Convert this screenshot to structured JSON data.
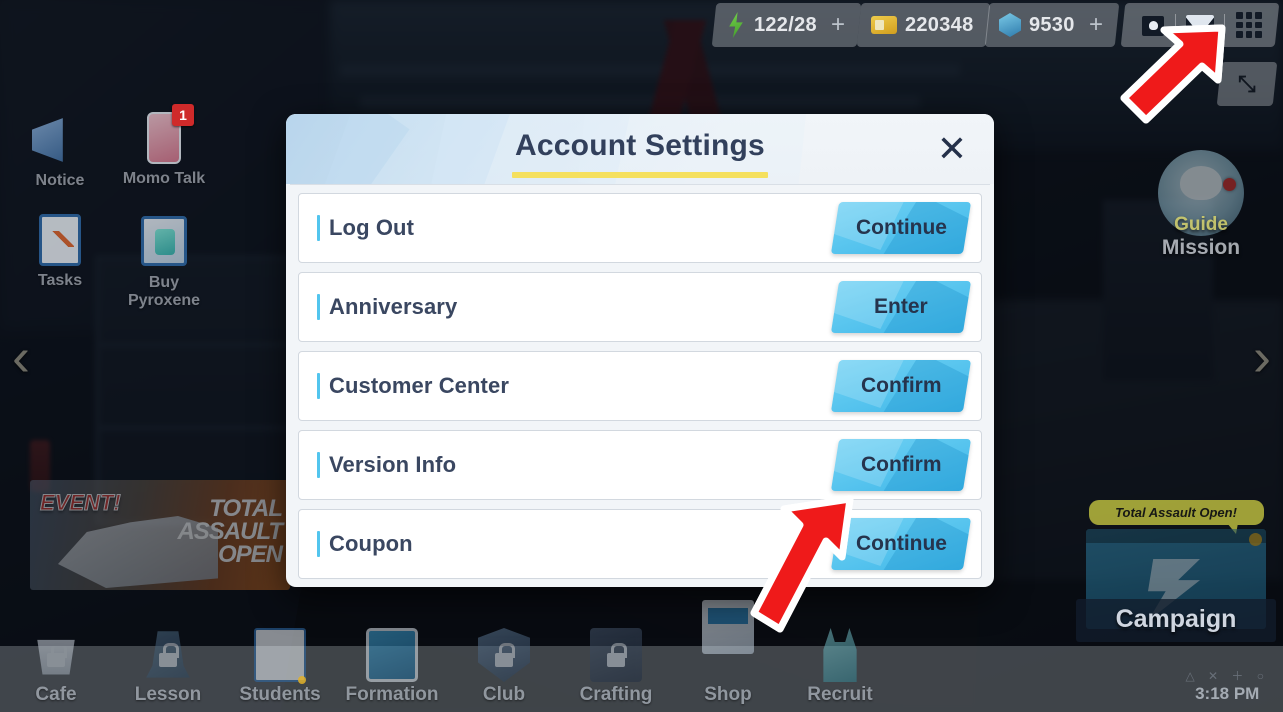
{
  "top_bar": {
    "resources": [
      {
        "icon": "ap-bolt-icon",
        "value": "122/28",
        "plus": "+"
      },
      {
        "icon": "credit-card-icon",
        "value": "220348",
        "plus": ""
      },
      {
        "icon": "pyroxene-gem-icon",
        "value": "9530",
        "plus": "+"
      }
    ],
    "buttons": [
      {
        "icon": "profile-icon",
        "name": "profile-button"
      },
      {
        "icon": "mail-icon",
        "name": "mail-button"
      },
      {
        "icon": "menu-grid-icon",
        "name": "menu-grid-button"
      }
    ],
    "expand_icon": "⤡"
  },
  "shortcuts": [
    {
      "label": "Notice",
      "icon": "megaphone-icon",
      "badge": ""
    },
    {
      "label": "Momo Talk",
      "icon": "phone-icon",
      "badge": "1"
    },
    {
      "label": "Tasks",
      "icon": "clipboard-icon",
      "badge": ""
    },
    {
      "label": "Buy Pyroxene",
      "icon": "shopping-bag-icon",
      "badge": ""
    }
  ],
  "nav_arrows": {
    "left": "‹",
    "right": "›"
  },
  "guide_mission": {
    "line1": "Guide",
    "line2": "Mission"
  },
  "event_banner": {
    "tag": "EVENT!",
    "line1": "TOTAL",
    "line2": "ASSAULT",
    "line3": "OPEN"
  },
  "campaign": {
    "bubble": "Total Assault Open!",
    "label": "Campaign"
  },
  "bottom_nav": {
    "items": [
      {
        "label": "Cafe",
        "icon": "coffee-cup-icon",
        "locked": true
      },
      {
        "label": "Lesson",
        "icon": "shoe-icon",
        "locked": true
      },
      {
        "label": "Students",
        "icon": "student-card-icon",
        "locked": false
      },
      {
        "label": "Formation",
        "icon": "tablet-icon",
        "locked": false
      },
      {
        "label": "Club",
        "icon": "shield-icon",
        "locked": true
      },
      {
        "label": "Crafting",
        "icon": "craft-device-icon",
        "locked": true
      },
      {
        "label": "Shop",
        "icon": "store-icon",
        "locked": false
      },
      {
        "label": "Recruit",
        "icon": "recruit-bag-icon",
        "locked": false
      }
    ],
    "clock_glyphs": "△ ✕ ＋ ○",
    "clock_time": "3:18 PM"
  },
  "dialog": {
    "title": "Account Settings",
    "close_icon": "✕",
    "rows": [
      {
        "label": "Log Out",
        "button": "Continue"
      },
      {
        "label": "Anniversary",
        "button": "Enter"
      },
      {
        "label": "Customer Center",
        "button": "Confirm"
      },
      {
        "label": "Version Info",
        "button": "Confirm"
      },
      {
        "label": "Coupon",
        "button": "Continue"
      }
    ]
  },
  "annotations": {
    "arrows": [
      {
        "name": "arrow-pointing-menu-grid",
        "color": "#ef1a1a"
      },
      {
        "name": "arrow-pointing-coupon-continue",
        "color": "#ef1a1a"
      }
    ]
  },
  "colors": {
    "accent_blue": "#52c5ee",
    "button_blue": "#5ac6ef",
    "title_navy": "#32405c",
    "title_underline": "#f5e05e",
    "arrow_red": "#ef1a1a"
  }
}
